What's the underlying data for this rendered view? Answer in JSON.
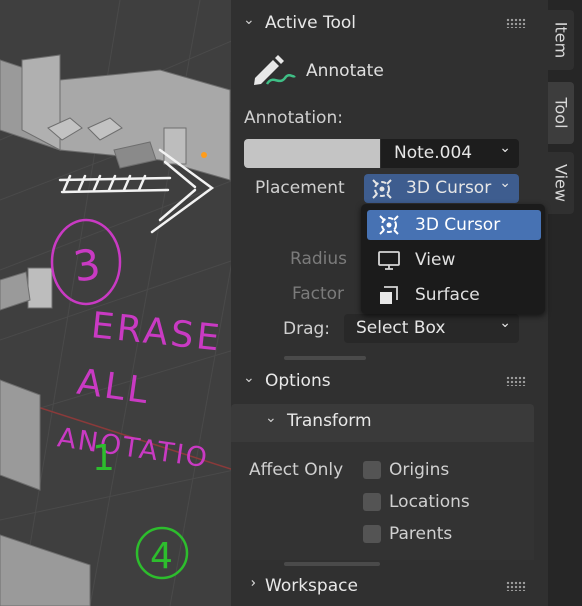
{
  "active_tool": {
    "header": "Active Tool",
    "tool_name": "Annotate",
    "annotation_label": "Annotation:",
    "annotation_color": "#c4c4c4",
    "note_value": "Note.004",
    "placement_label": "Placement",
    "placement_value": "3D Cursor",
    "radius_label": "Radius",
    "factor_label": "Factor",
    "drag_label": "Drag:",
    "drag_value": "Select Box"
  },
  "placement_menu": {
    "items": [
      {
        "label": "3D Cursor",
        "icon": "cursor-icon",
        "selected": true
      },
      {
        "label": "View",
        "icon": "monitor-icon",
        "selected": false
      },
      {
        "label": "Surface",
        "icon": "surface-icon",
        "selected": false
      }
    ]
  },
  "options": {
    "header": "Options",
    "transform_header": "Transform",
    "affect_only_label": "Affect Only",
    "checkboxes": [
      {
        "label": "Origins",
        "checked": false
      },
      {
        "label": "Locations",
        "checked": false
      },
      {
        "label": "Parents",
        "checked": false
      }
    ]
  },
  "workspace": {
    "header": "Workspace"
  },
  "side_tabs": [
    "Item",
    "Tool",
    "View"
  ],
  "viewport_annotations": {
    "numbers": [
      "3",
      "1",
      "4"
    ],
    "words": [
      "ERASE",
      "ALL",
      "ANOTATIO"
    ]
  },
  "colors": {
    "selected_item": "#4772b3",
    "placement_dropdown": "#3e5d8f",
    "magenta_ink": "#c93ac3",
    "green_ink": "#2dbd2d",
    "white_ink": "#f2f2f2"
  }
}
